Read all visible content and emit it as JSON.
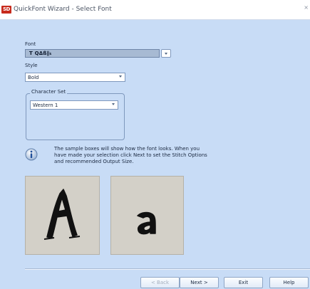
{
  "window": {
    "logo_text": "SD",
    "title": "QuickFont Wizard - Select Font",
    "close_glyph": "×"
  },
  "font": {
    "label": "Font",
    "value": "T QΔß∥ₖ"
  },
  "style": {
    "label": "Style",
    "value": "Bold"
  },
  "character_set": {
    "label": "Character Set",
    "value": "Western 1"
  },
  "info": {
    "icon": "info-icon",
    "text": "The sample boxes will show how the font looks. When you have made your selection click Next to set the Stitch Options and recommended Output Size."
  },
  "samples": {
    "upper": "A",
    "lower": "a"
  },
  "buttons": {
    "back": "< Back",
    "next": "Next >",
    "exit": "Exit",
    "help": "Help"
  },
  "colors": {
    "background": "#c8dcf6",
    "sample_bg": "#d3d0c8",
    "logo": "#c72a1c"
  }
}
